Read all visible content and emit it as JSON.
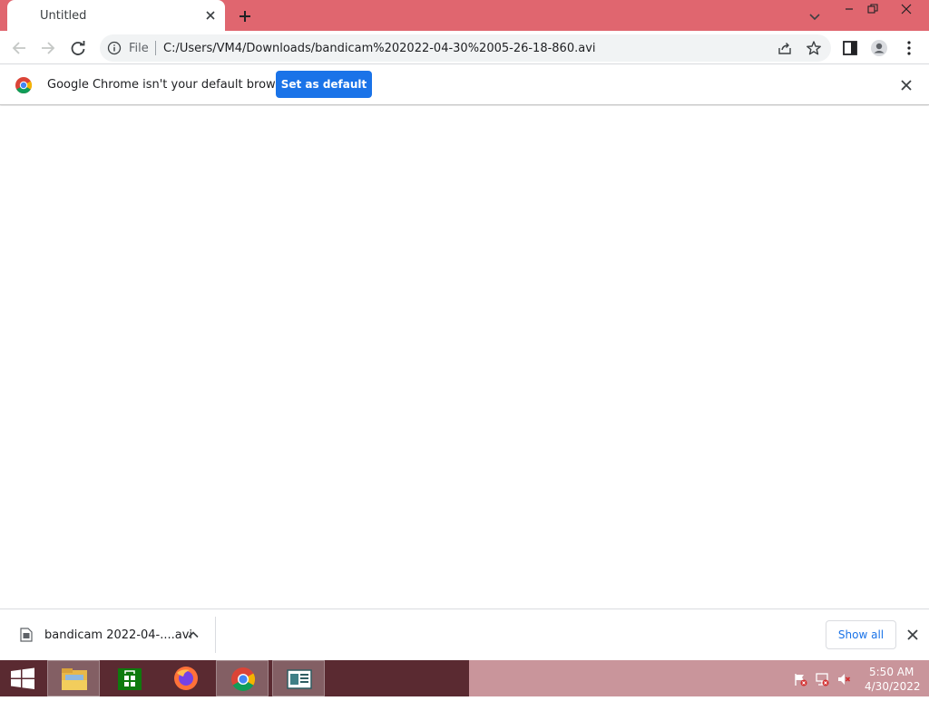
{
  "tab": {
    "title": "Untitled"
  },
  "omnibox": {
    "scheme_label": "File",
    "url": "C:/Users/VM4/Downloads/bandicam%202022-04-30%2005-26-18-860.avi"
  },
  "infobar": {
    "message": "Google Chrome isn't your default browser",
    "button_label": "Set as default"
  },
  "downloads": {
    "file_name": "bandicam 2022-04-....avi",
    "show_all_label": "Show all"
  },
  "taskbar": {
    "time": "5:50 AM",
    "date": "4/30/2022",
    "pinned": [
      "file-explorer",
      "store",
      "firefox",
      "chrome",
      "news-app"
    ]
  },
  "colors": {
    "tabstrip": "#e0666f",
    "accent": "#1a73e8",
    "taskbar": "#5a2a31"
  }
}
